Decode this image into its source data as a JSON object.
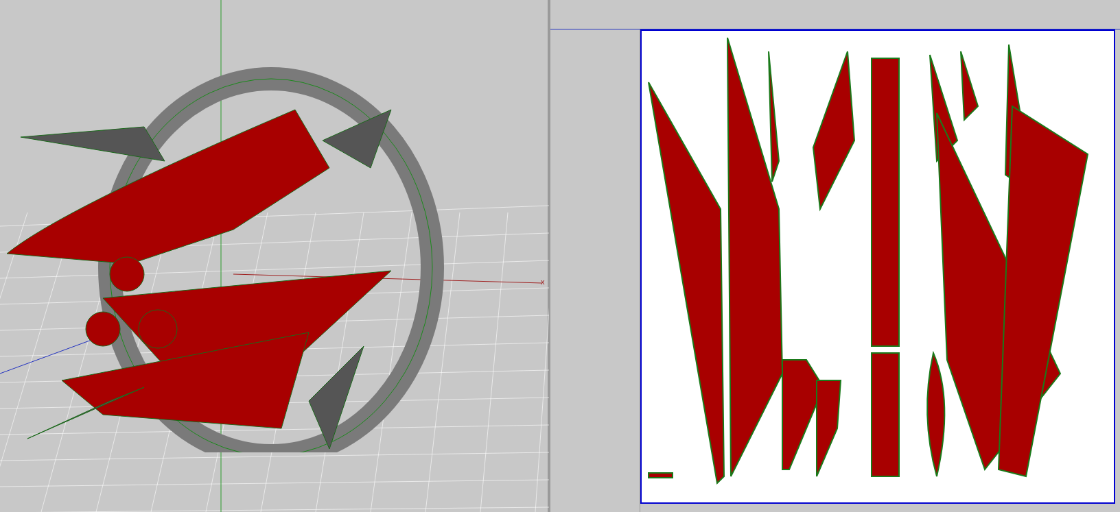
{
  "viewport": {
    "axis_label": "x"
  }
}
